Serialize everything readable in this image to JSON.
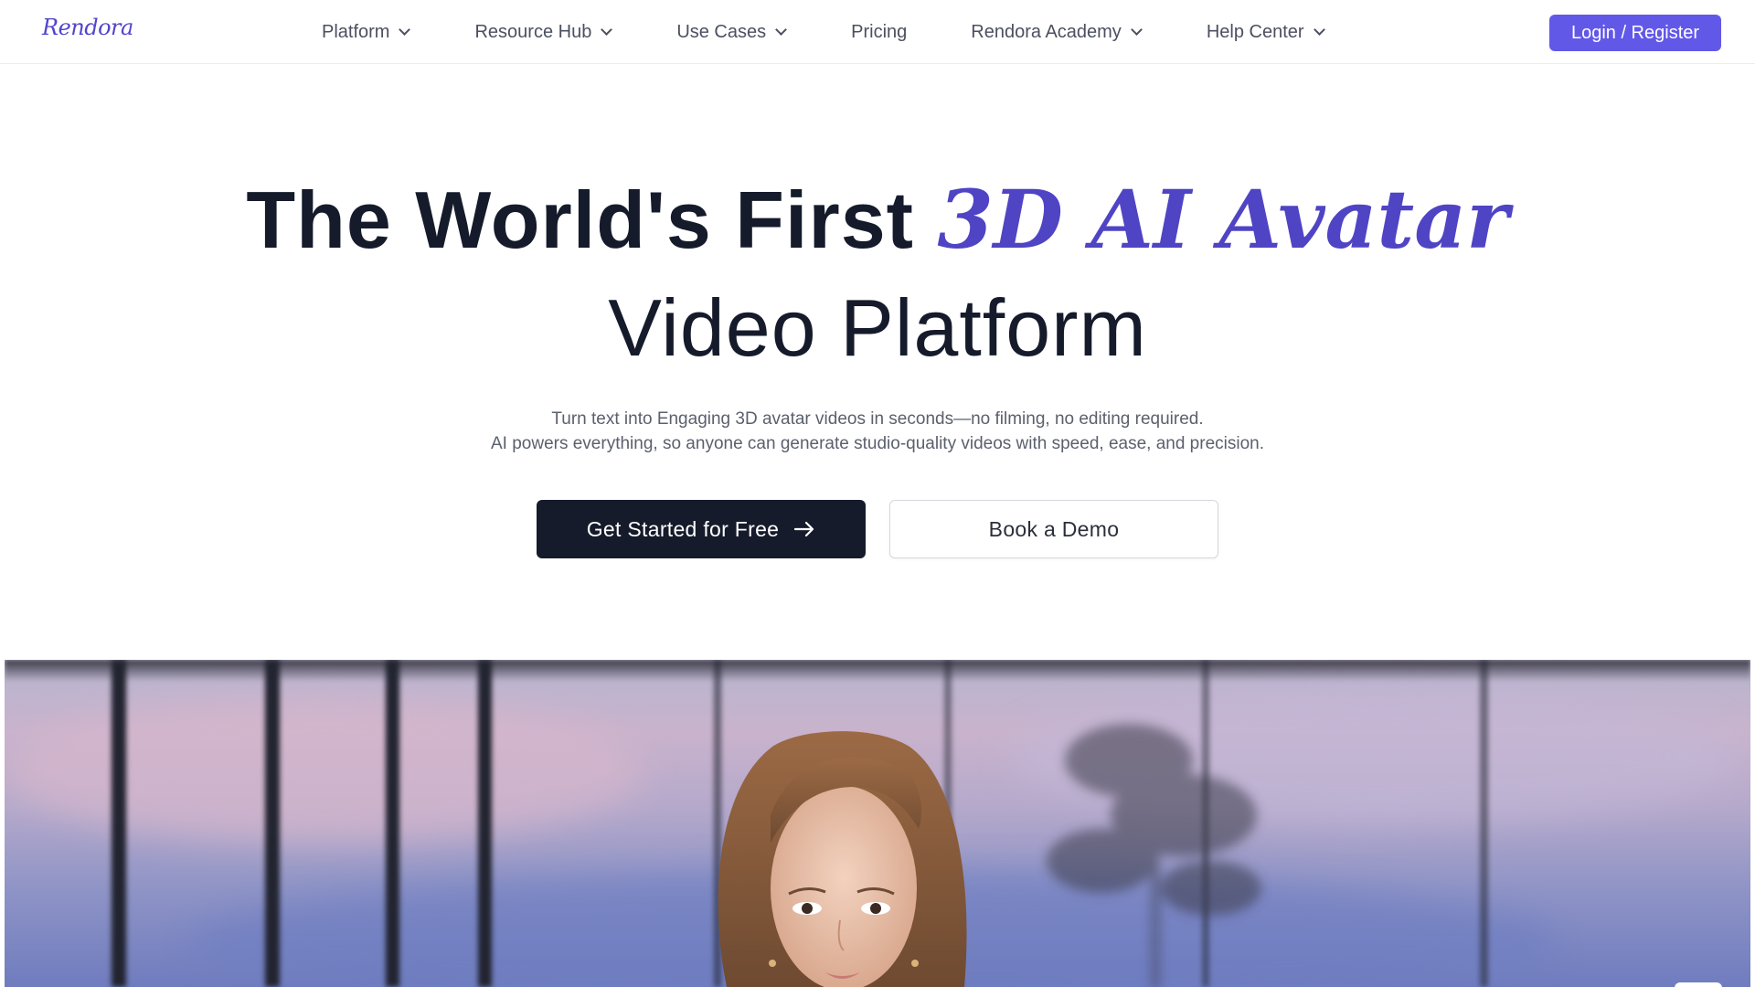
{
  "brand": {
    "logo_text": "Rendora",
    "accent_color": "#6258e8",
    "headline_accent_color": "#4f44c4"
  },
  "nav": {
    "items": [
      {
        "label": "Platform",
        "has_dropdown": true
      },
      {
        "label": "Resource Hub",
        "has_dropdown": true
      },
      {
        "label": "Use Cases",
        "has_dropdown": true
      },
      {
        "label": "Pricing",
        "has_dropdown": false
      },
      {
        "label": "Rendora Academy",
        "has_dropdown": true
      },
      {
        "label": "Help Center",
        "has_dropdown": true
      }
    ],
    "login_label": "Login / Register"
  },
  "hero": {
    "title_prefix": "The World's First ",
    "title_accent": "3D AI Avatar",
    "title_line2": "Video Platform",
    "subtitle_line1": "Turn text into Engaging 3D avatar videos in seconds—no filming, no editing required.",
    "subtitle_line2": "AI powers everything, so anyone can generate studio-quality videos with speed, ease, and precision.",
    "cta_primary": "Get Started for Free",
    "cta_secondary": "Book a Demo"
  }
}
